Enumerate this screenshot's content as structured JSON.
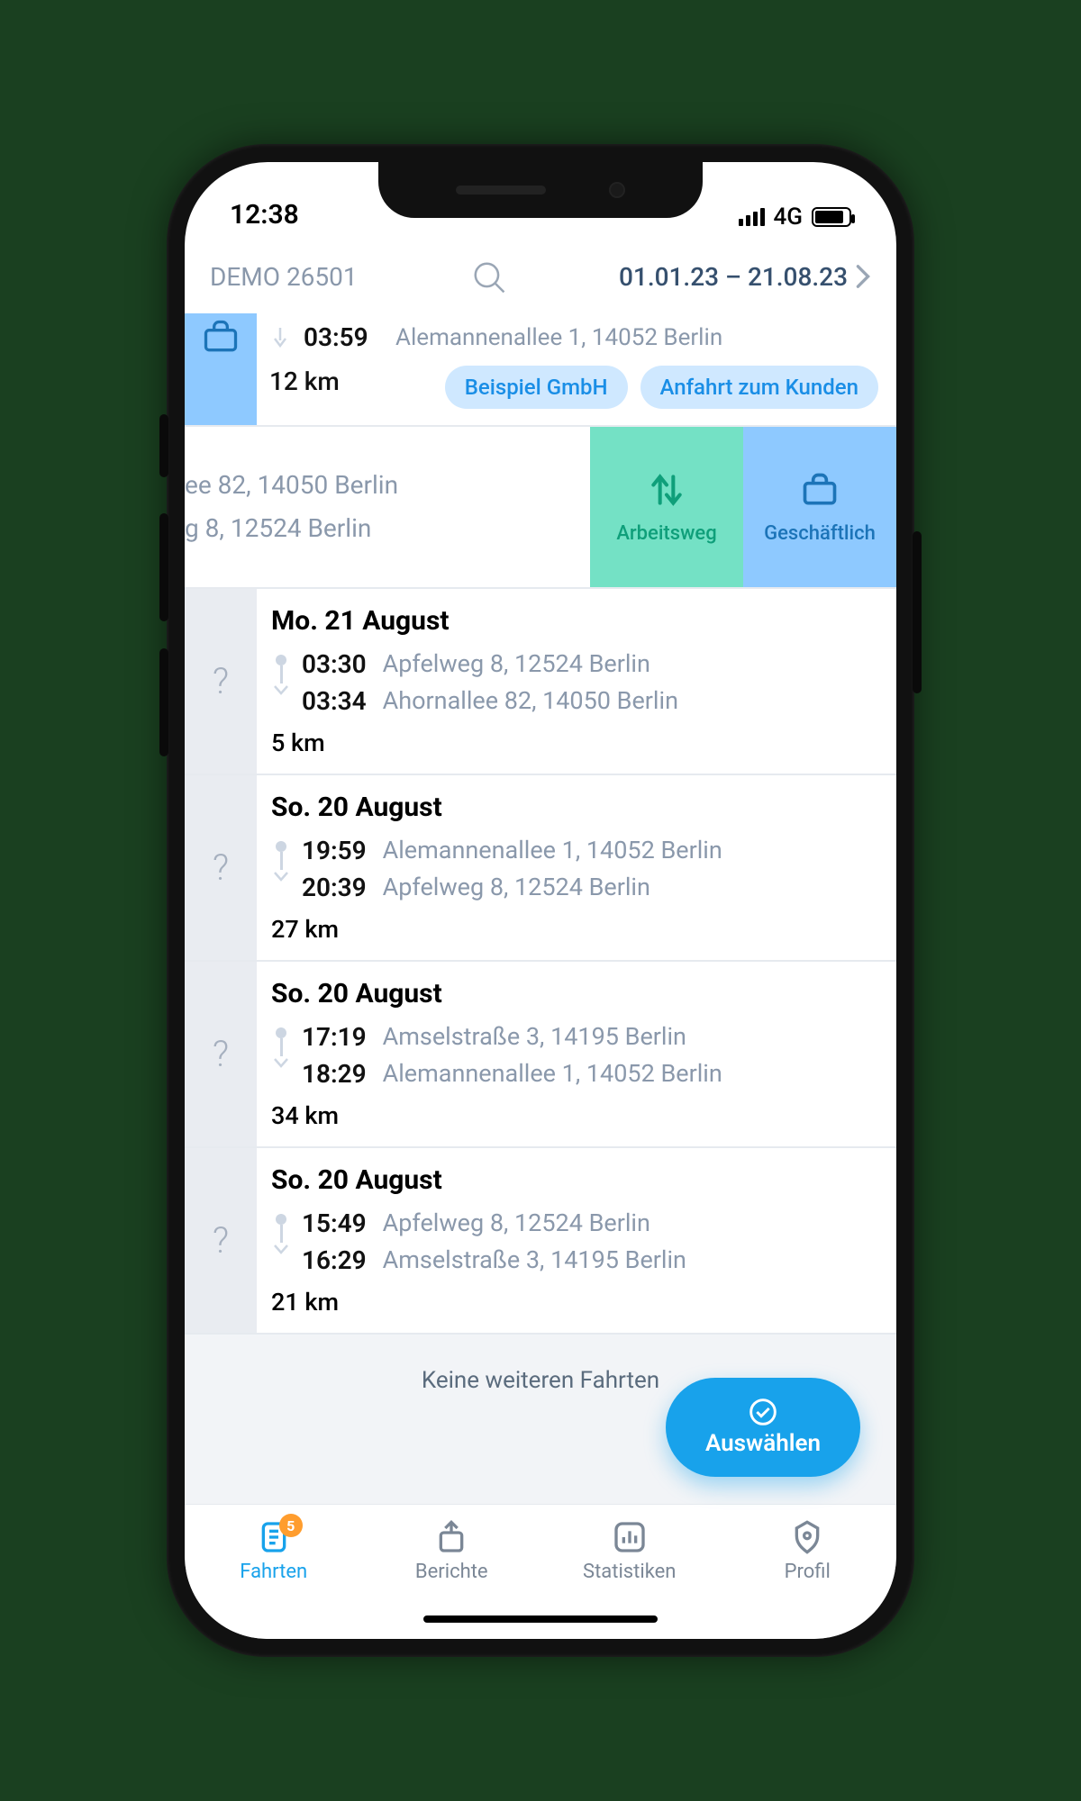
{
  "status": {
    "time": "12:38",
    "network": "4G"
  },
  "header": {
    "demo": "DEMO 26501",
    "date_range": "01.01.23 – 21.08.23"
  },
  "partial_trip": {
    "end_time": "03:59",
    "end_addr": "Alemannenallee 1, 14052 Berlin",
    "distance": "12 km",
    "chip1": "Beispiel GmbH",
    "chip2": "Anfahrt zum Kunden"
  },
  "swipe": {
    "line1": "ee 82, 14050 Berlin",
    "line2": "g 8, 12524 Berlin",
    "commute": "Arbeitsweg",
    "business": "Geschäftlich"
  },
  "trips": [
    {
      "title": "Mo. 21 August",
      "t1": "03:30",
      "a1": "Apfelweg 8, 12524 Berlin",
      "t2": "03:34",
      "a2": "Ahornallee 82, 14050 Berlin",
      "dist": "5 km"
    },
    {
      "title": "So. 20 August",
      "t1": "19:59",
      "a1": "Alemannenallee 1, 14052 Berlin",
      "t2": "20:39",
      "a2": "Apfelweg 8, 12524 Berlin",
      "dist": "27 km"
    },
    {
      "title": "So. 20 August",
      "t1": "17:19",
      "a1": "Amselstraße 3, 14195 Berlin",
      "t2": "18:29",
      "a2": "Alemannenallee 1, 14052 Berlin",
      "dist": "34 km"
    },
    {
      "title": "So. 20 August",
      "t1": "15:49",
      "a1": "Apfelweg 8, 12524 Berlin",
      "t2": "16:29",
      "a2": "Amselstraße 3, 14195 Berlin",
      "dist": "21 km"
    }
  ],
  "no_more": "Keine weiteren Fahrten",
  "fab": "Auswählen",
  "tabs": {
    "trips": "Fahrten",
    "reports": "Berichte",
    "stats": "Statistiken",
    "profile": "Profil",
    "badge": "5"
  },
  "icons": {
    "unknown": "?"
  }
}
